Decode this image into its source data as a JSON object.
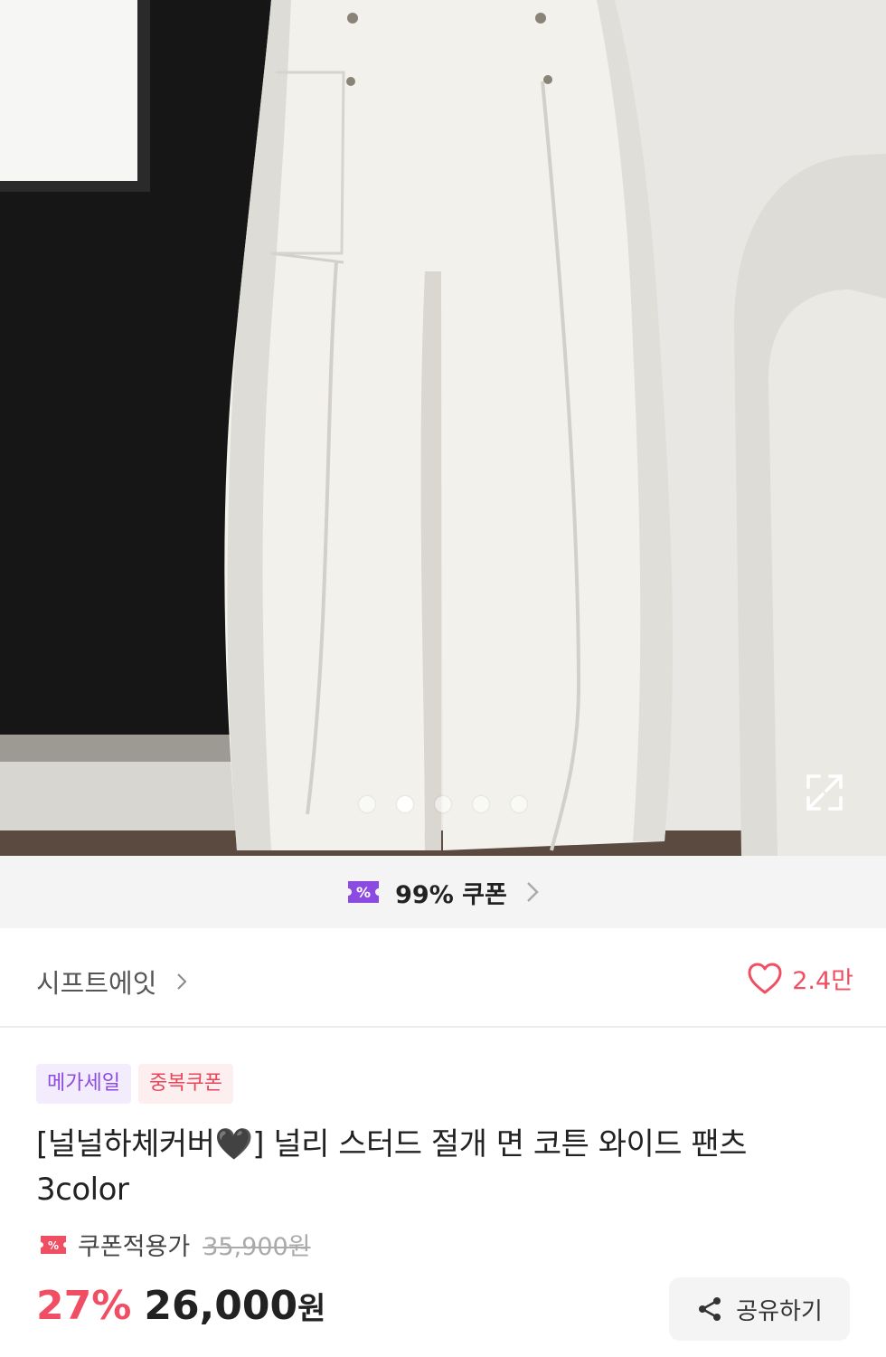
{
  "hero": {
    "image_alt": "white wide cotton pants on mannequin",
    "slide_count": 5,
    "active_slide": 2
  },
  "coupon_bar": {
    "label": "99% 쿠폰",
    "accent": "#8b4be0"
  },
  "store": {
    "name": "시프트에잇",
    "likes": "2.4만"
  },
  "tags": [
    {
      "label": "메가세일"
    },
    {
      "label": "중복쿠폰"
    }
  ],
  "product": {
    "title_line1": "[널널하체커버🖤] 널리 스터드 절개 면 코튼 와이드 팬츠",
    "title_line2": "3color",
    "coupon_price_label": "쿠폰적용가",
    "original_price": "35,900원",
    "discount": "27%",
    "price": "26,000",
    "currency": "원"
  },
  "share": {
    "label": "공유하기"
  },
  "colors": {
    "discount_red": "#f04e62",
    "brand_purple": "#8b4be0"
  }
}
